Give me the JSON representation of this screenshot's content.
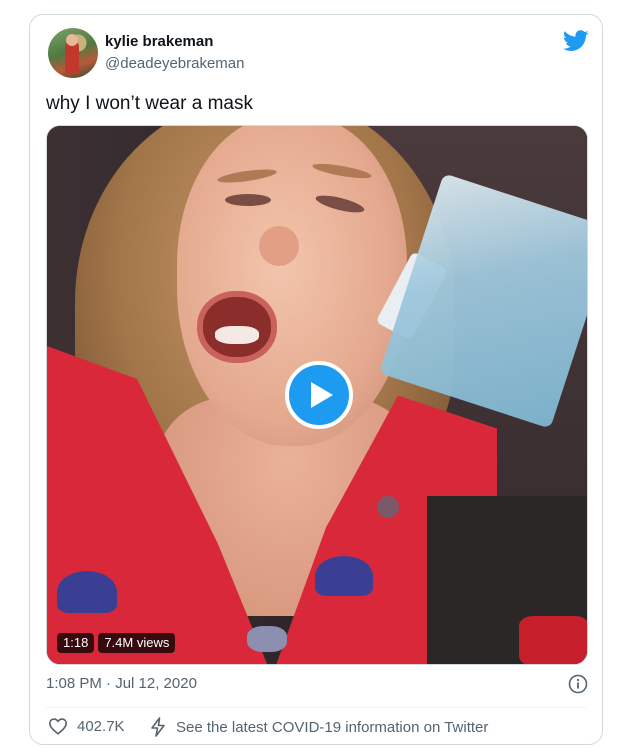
{
  "author": {
    "name": "kylie brakeman",
    "handle": "@deadeyebrakeman"
  },
  "tweet": {
    "text": "why I won’t wear a mask",
    "timestamp": "1:08 PM · Jul 12, 2020"
  },
  "video": {
    "duration": "1:18",
    "views": "7.4M views"
  },
  "actions": {
    "likes": "402.7K",
    "covid_notice": "See the latest COVID-19 information on Twitter"
  },
  "colors": {
    "twitter_blue": "#1d9bf0",
    "secondary_text": "#536471"
  },
  "icons": [
    "twitter-bird-icon",
    "play-icon",
    "info-icon",
    "heart-icon",
    "bolt-icon"
  ]
}
